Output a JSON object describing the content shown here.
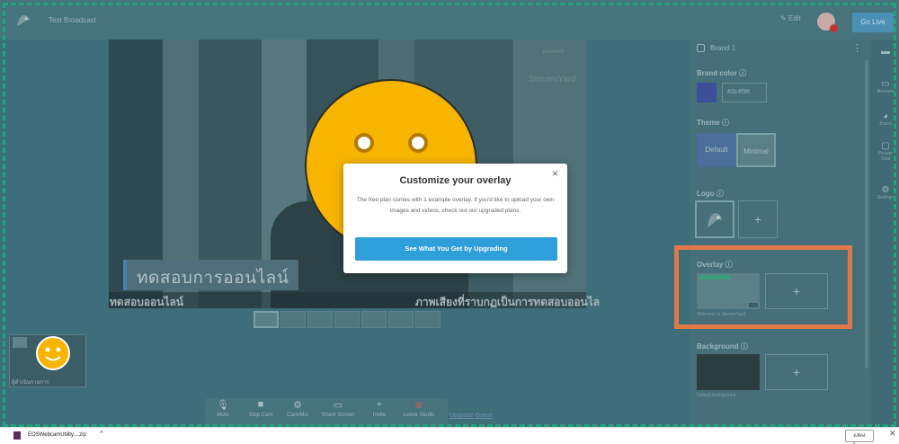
{
  "topbar": {
    "title": "Test Broadcast",
    "edit_label": "✎ Edit",
    "go_live_label": "Go Live"
  },
  "stage": {
    "caption": "ทดสอบการออนไลน์",
    "ticker_left": "ทดสอบออนไลน์",
    "ticker_right": "ภาพเสียงที่ราบกฏเป็นการทดสอบออนไล",
    "watermark": "StreamYard",
    "watermark_sub": "powered"
  },
  "modal": {
    "title": "Customize your overlay",
    "body": "The free plan comes with 1 example overlay. If you'd like to upload your own images and videos, check out our upgraded plans.",
    "cta": "See What You Get by Upgrading",
    "close": "×"
  },
  "toolbar": {
    "items": [
      {
        "label": "Mute",
        "icon": "mic-icon"
      },
      {
        "label": "Stop Cam",
        "icon": "camera-icon"
      },
      {
        "label": "Cam/Mic",
        "icon": "gear-icon"
      },
      {
        "label": "Share Screen",
        "icon": "monitor-icon"
      },
      {
        "label": "Invite",
        "icon": "add-person-icon"
      },
      {
        "label": "Leave Studio",
        "icon": "leave-icon"
      }
    ],
    "upgrade_link": "Upgrade Guest"
  },
  "participant": {
    "label": "ผู้ดำเนินรายการ"
  },
  "right_panel": {
    "brand": "Brand 1",
    "brand_color_label": "Brand color ⓘ",
    "brand_color_hex": "#3c4f98",
    "brand_color_value": "#3c4f98",
    "theme_label": "Theme ⓘ",
    "theme_default": "Default",
    "theme_minimal": "Minimal",
    "logo_label": "Logo ⓘ",
    "overlay_label": "Overlay ⓘ",
    "overlay_caption": "Welcome to StreamYard",
    "background_label": "Background ⓘ",
    "background_caption": "Default background"
  },
  "rail": {
    "items": [
      {
        "label": "",
        "icon": "chat-icon"
      },
      {
        "label": "Banners",
        "icon": "banner-icon"
      },
      {
        "label": "Brand",
        "icon": "palette-icon"
      },
      {
        "label": "Private Chat",
        "icon": "private-chat-icon"
      },
      {
        "label": "Settings",
        "icon": "settings-icon"
      }
    ]
  },
  "download_bar": {
    "filename": "EOSWebcamUtility....zip",
    "show_all": "แสดงทั้งหมด",
    "close": "✕"
  },
  "colors": {
    "highlight": "#e0794a",
    "dashed_border": "#1fa37a",
    "cta": "#2f9fd9",
    "smiley": "#f7b500"
  }
}
